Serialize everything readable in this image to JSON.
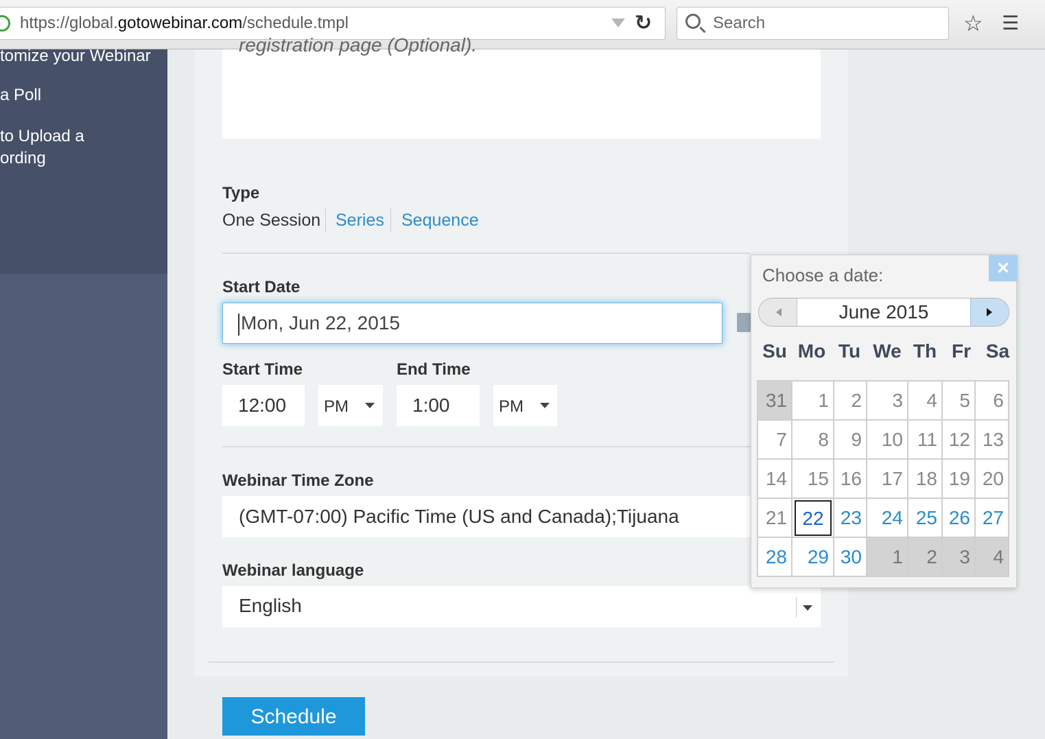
{
  "browser": {
    "url_prefix": "https://global.",
    "url_domain": "gotowebinar.com",
    "url_path": "/schedule.tmpl",
    "search_placeholder": "Search"
  },
  "sidebar": {
    "items": [
      "tomize your Webinar",
      "a Poll",
      "to Upload a",
      "ording"
    ]
  },
  "form": {
    "description_placeholder": "registration page (Optional).",
    "type_label": "Type",
    "type_options": [
      "One Session",
      "Series",
      "Sequence"
    ],
    "start_date_label": "Start Date",
    "start_date_value": "Mon, Jun 22, 2015",
    "start_time_label": "Start Time",
    "start_time_value": "12:00",
    "start_ampm": "PM",
    "end_time_label": "End Time",
    "end_time_value": "1:00",
    "end_ampm": "PM",
    "timezone_label": "Webinar Time Zone",
    "timezone_value": "(GMT-07:00) Pacific Time (US and Canada);Tijuana",
    "language_label": "Webinar language",
    "language_value": "English",
    "schedule_button": "Schedule"
  },
  "datepicker": {
    "title": "Choose a date:",
    "close": "×",
    "month_label": "June 2015",
    "weekdays": [
      "Su",
      "Mo",
      "Tu",
      "We",
      "Th",
      "Fr",
      "Sa"
    ],
    "weeks": [
      [
        {
          "d": "31",
          "s": "other"
        },
        {
          "d": "1",
          "s": "past"
        },
        {
          "d": "2",
          "s": "past"
        },
        {
          "d": "3",
          "s": "past"
        },
        {
          "d": "4",
          "s": "past"
        },
        {
          "d": "5",
          "s": "past"
        },
        {
          "d": "6",
          "s": "past"
        }
      ],
      [
        {
          "d": "7",
          "s": "past"
        },
        {
          "d": "8",
          "s": "past"
        },
        {
          "d": "9",
          "s": "past"
        },
        {
          "d": "10",
          "s": "past"
        },
        {
          "d": "11",
          "s": "past"
        },
        {
          "d": "12",
          "s": "past"
        },
        {
          "d": "13",
          "s": "past"
        }
      ],
      [
        {
          "d": "14",
          "s": "past"
        },
        {
          "d": "15",
          "s": "past"
        },
        {
          "d": "16",
          "s": "past"
        },
        {
          "d": "17",
          "s": "past"
        },
        {
          "d": "18",
          "s": "past"
        },
        {
          "d": "19",
          "s": "past"
        },
        {
          "d": "20",
          "s": "past"
        }
      ],
      [
        {
          "d": "21",
          "s": "past"
        },
        {
          "d": "22",
          "s": "today"
        },
        {
          "d": "23",
          "s": "avail"
        },
        {
          "d": "24",
          "s": "avail"
        },
        {
          "d": "25",
          "s": "avail"
        },
        {
          "d": "26",
          "s": "avail"
        },
        {
          "d": "27",
          "s": "avail"
        }
      ],
      [
        {
          "d": "28",
          "s": "avail"
        },
        {
          "d": "29",
          "s": "avail"
        },
        {
          "d": "30",
          "s": "avail"
        },
        {
          "d": "1",
          "s": "other"
        },
        {
          "d": "2",
          "s": "other"
        },
        {
          "d": "3",
          "s": "other"
        },
        {
          "d": "4",
          "s": "other"
        }
      ]
    ]
  }
}
